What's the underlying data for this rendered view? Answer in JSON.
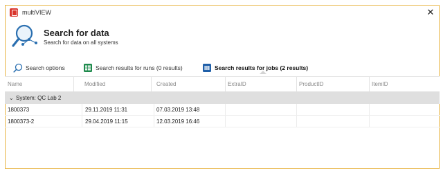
{
  "window": {
    "title": "multiVIEW",
    "close_glyph": "✕"
  },
  "header": {
    "title": "Search for data",
    "subtitle": "Search for data on all systems",
    "icon": "search-magnifier-icon"
  },
  "tabs": [
    {
      "label": "Search options",
      "icon": "search-icon",
      "active": false
    },
    {
      "label": "Search results for runs (0 results)",
      "icon": "spreadsheet-icon",
      "active": false
    },
    {
      "label": "Search results for jobs (2 results)",
      "icon": "jobs-icon",
      "active": true
    }
  ],
  "table": {
    "columns": [
      "Name",
      "Modified",
      "Created",
      "ExtraID",
      "ProductID",
      "ItemID"
    ],
    "group": {
      "chevron": "⌄",
      "label": "System: QC Lab 2"
    },
    "rows": [
      {
        "name": "1800373",
        "modified": "29.11.2019 11:31",
        "created": "07.03.2019 13:48",
        "extra_id": "",
        "product_id": "",
        "item_id": ""
      },
      {
        "name": "1800373-2",
        "modified": "29.04.2019 11:15",
        "created": "12.03.2019 16:46",
        "extra_id": "",
        "product_id": "",
        "item_id": ""
      }
    ]
  },
  "colors": {
    "window_border": "#e8b341",
    "app_icon": "#d9342b",
    "group_row_bg": "#dfdfdf",
    "runs_icon": "#1e8a4c",
    "jobs_icon": "#1f5fa8"
  }
}
